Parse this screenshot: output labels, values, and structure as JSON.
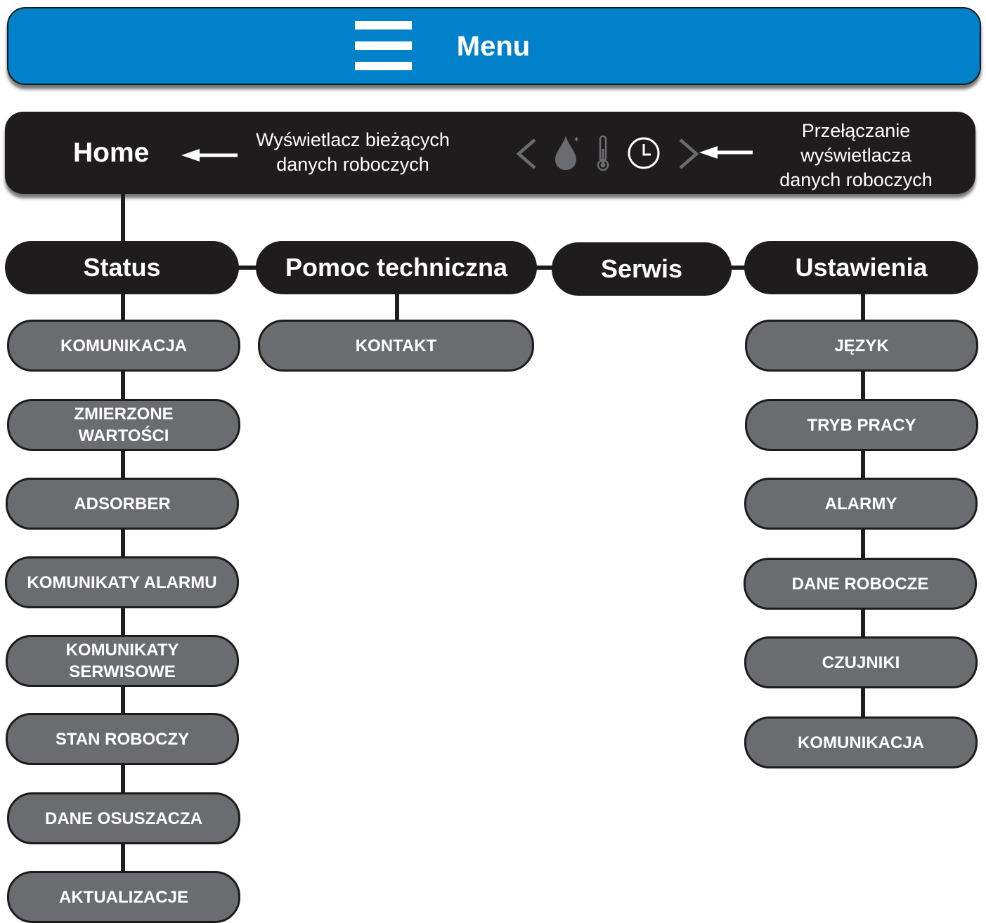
{
  "menu": {
    "title": "Menu"
  },
  "home": {
    "title": "Home",
    "display_note": "Wyświetlacz bieżących\ndanych roboczych",
    "switch_note": "Przełączanie\nwyświetlacza\ndanych roboczych",
    "icons": [
      "chevron-left-icon",
      "water-drop-icon",
      "thermometer-icon",
      "clock-icon",
      "chevron-right-icon"
    ]
  },
  "categories": {
    "status": "Status",
    "help": "Pomoc techniczna",
    "service": "Serwis",
    "settings": "Ustawienia"
  },
  "status_items": [
    "KOMUNIKACJA",
    "ZMIERZONE\nWARTOŚCI",
    "ADSORBER",
    "KOMUNIKATY ALARMU",
    "KOMUNIKATY\nSERWISOWE",
    "STAN ROBOCZY",
    "DANE OSUSZACZA",
    "AKTUALIZACJE"
  ],
  "help_items": [
    "KONTAKT"
  ],
  "settings_items": [
    "JĘZYK",
    "TRYB PRACY",
    "ALARMY",
    "DANE ROBOCZE",
    "CZUJNIKI",
    "KOMUNIKACJA"
  ],
  "colors": {
    "menu_bar": "#0081c9",
    "dark_pill": "#1f1c1d",
    "sub_pill": "#6b6c6f",
    "icon_grey": "#6b6c6f"
  }
}
